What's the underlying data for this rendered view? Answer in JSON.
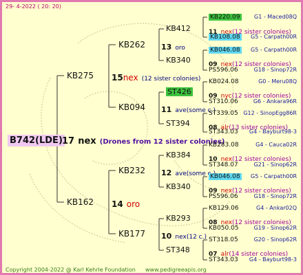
{
  "header": {
    "date": "29-  4-2022 ( 20: 20)"
  },
  "footer": {
    "copyright": "Copyright 2004-2022 @ Karl Kehrle Foundation",
    "url": "www.pedigreeapis.org"
  },
  "colors": {
    "border": "#e07ab0",
    "background": "#ffffcf",
    "highlight_green": "#3ec23e",
    "highlight_cyan": "#5fd7f0",
    "gen_red": "#d00000"
  },
  "root": {
    "name": "B742(LDE)",
    "num": "17",
    "gen": "nex",
    "note": "(Drones from 12 sister colonies)"
  },
  "gen2": [
    {
      "name": "KB275",
      "num": "15",
      "gen": "nex",
      "note": "(12 sister colonies)"
    },
    {
      "name": "KB162",
      "num": "14",
      "gen": "oro",
      "note": ""
    }
  ],
  "gen3": [
    {
      "name": "KB262",
      "num": "13",
      "gen": "oro",
      "note": ""
    },
    {
      "name": "KB094",
      "num": "11",
      "gen": "ave",
      "note": "(some c.)"
    },
    {
      "name": "KB232",
      "num": "12",
      "gen": "ave",
      "note": "(some c.)"
    },
    {
      "name": "KB177",
      "num": "10",
      "gen": "nex",
      "note": "(12 c.)"
    }
  ],
  "gen4": [
    {
      "name": "KB412",
      "num": "11",
      "gen": "nex",
      "note": "(12 sister colonies)"
    },
    {
      "name": "KB340",
      "num": "09",
      "gen": "nex",
      "note": "(12 sister colonies)"
    },
    {
      "name": "ST426",
      "num": "09",
      "gen": "nyc",
      "note": "(12 sister colonies)"
    },
    {
      "name": "ST394",
      "num": "08",
      "gen": "alr",
      "note": "(13 sister colonies)"
    },
    {
      "name": "KB384",
      "num": "10",
      "gen": "nex",
      "note": "(12 sister colonies)"
    },
    {
      "name": "KB340",
      "num": "09",
      "gen": "nex",
      "note": "(12 sister colonies)"
    },
    {
      "name": "KB293",
      "num": "08",
      "gen": "nex",
      "note": "(12 sister colonies)"
    },
    {
      "name": "ST348",
      "num": "07",
      "gen": "alr",
      "note": "(14 sister colonies)"
    }
  ],
  "gen5": [
    {
      "name": "KB220.09",
      "origin": "G1 - Maced08Q"
    },
    {
      "name": "KB108.08",
      "origin": "G5 - Carpath00R"
    },
    {
      "name": "KB046.08",
      "origin": "G5 - Carpath00R"
    },
    {
      "name": "PS596.06",
      "origin": "G18 - Sinop72R"
    },
    {
      "name": "KB024.08",
      "origin": "G0 - Meru08Q"
    },
    {
      "name": "ST310.06",
      "origin": "G6 - Ankara96R"
    },
    {
      "name": "ST339.05",
      "origin": "G12 - SinopEgg86R"
    },
    {
      "name": "ST343.03",
      "origin": "G4 - Bayburt98-3"
    },
    {
      "name": "KB283.08",
      "origin": "G4 - Cauca02R"
    },
    {
      "name": "ST348.07",
      "origin": "G21 - Sinop62R"
    },
    {
      "name": "KB046.08",
      "origin": "G5 - Carpath00R"
    },
    {
      "name": "PS596.06",
      "origin": "G18 - Sinop72R"
    },
    {
      "name": "KB129.06",
      "origin": "G4 - Ankar02Q"
    },
    {
      "name": "KB050.05",
      "origin": "G19 - Sinop62R"
    },
    {
      "name": "ST318.05",
      "origin": "G20 - Sinop62R"
    },
    {
      "name": "ST343.03",
      "origin": "G4 - Bayburt98-3"
    }
  ]
}
